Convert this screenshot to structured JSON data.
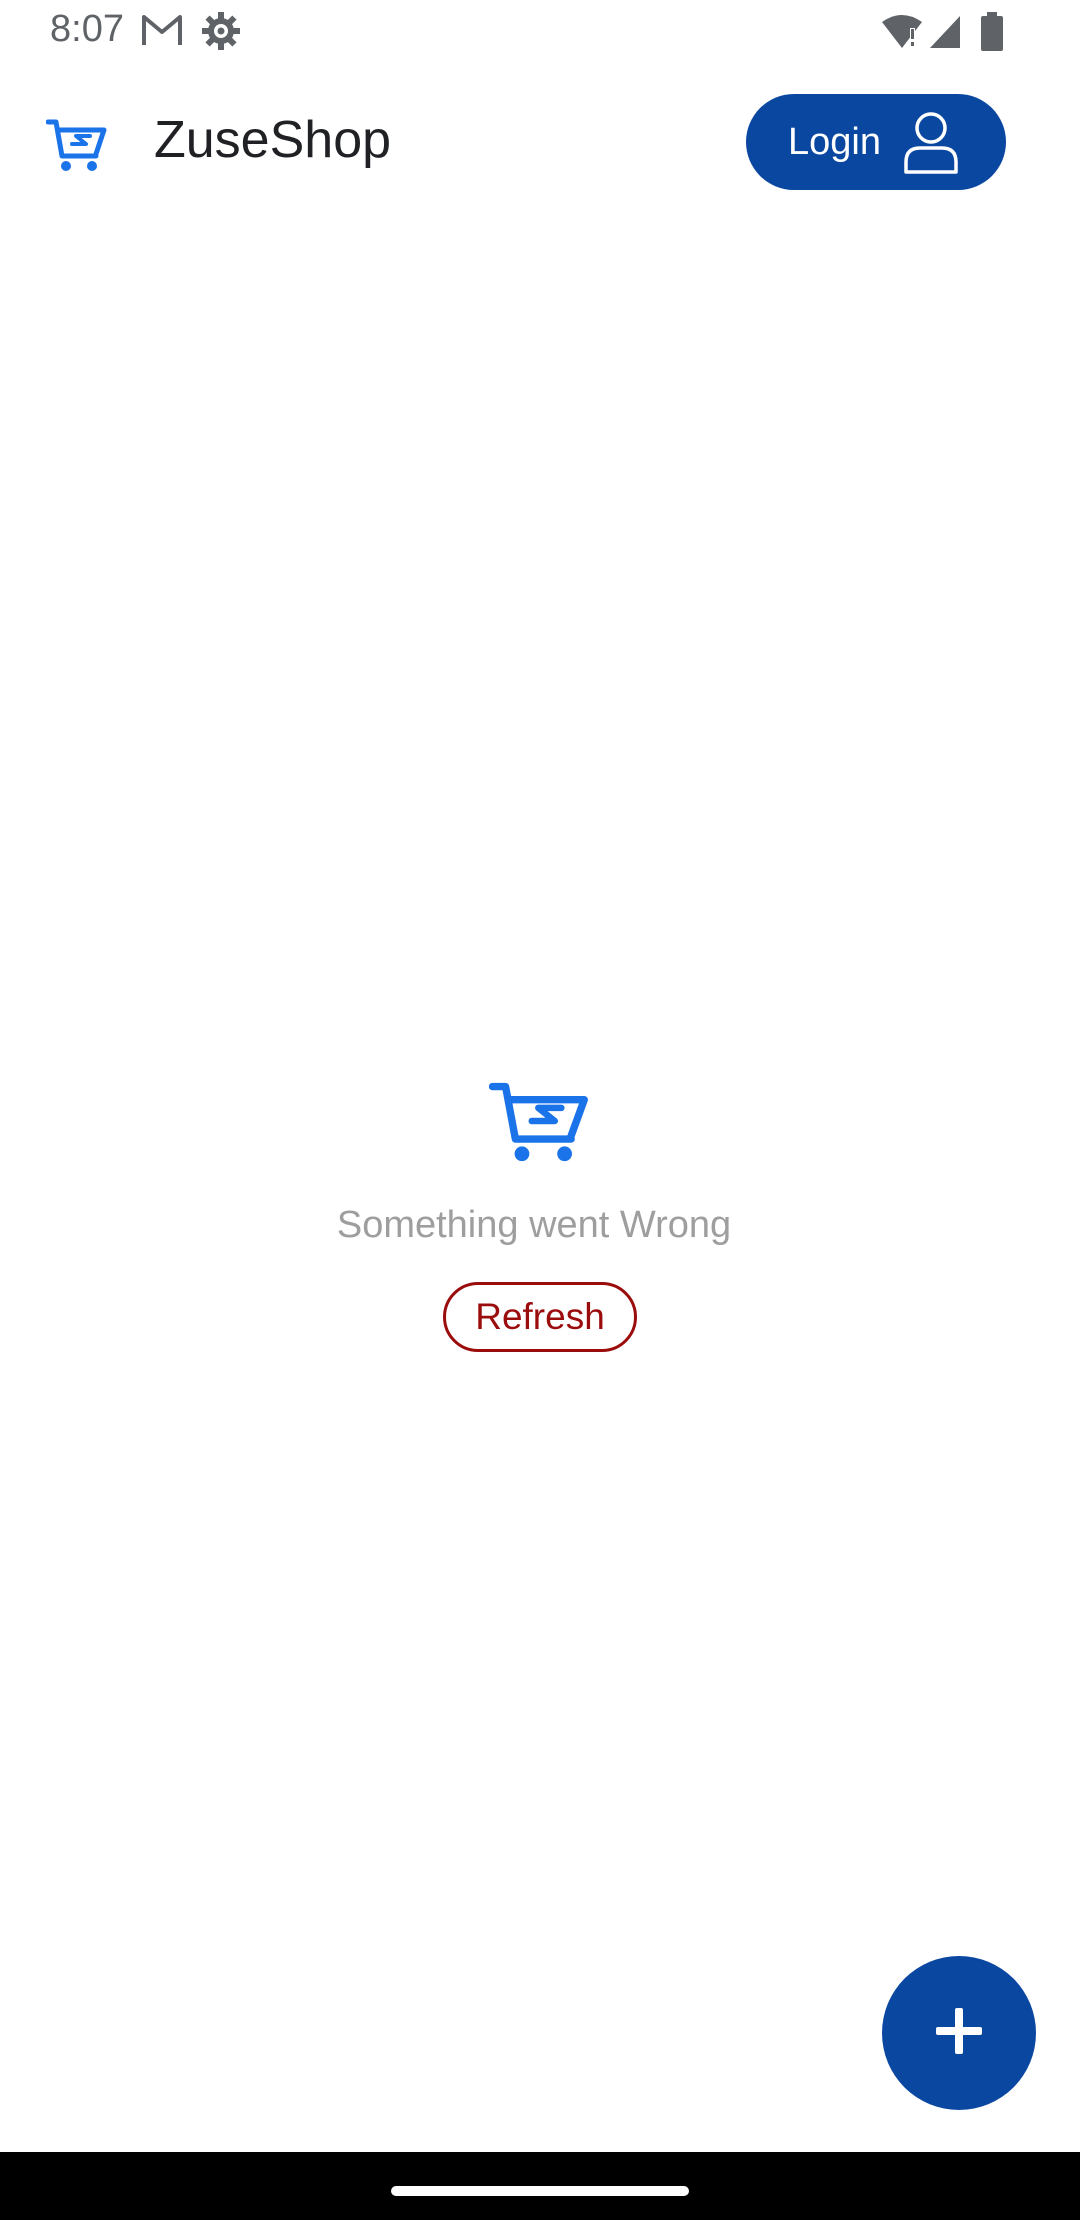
{
  "status_bar": {
    "time": "8:07",
    "icons": [
      "gmail-icon",
      "settings-gear-icon",
      "wifi-alert-icon",
      "cell-signal-icon",
      "battery-icon"
    ]
  },
  "app_bar": {
    "title": "ZuseShop",
    "logo_icon": "cart-icon",
    "login_label": "Login",
    "login_icon": "user-icon"
  },
  "error_state": {
    "icon": "cart-icon",
    "message": "Something went Wrong",
    "refresh_label": "Refresh"
  },
  "fab": {
    "icon": "plus-icon"
  },
  "colors": {
    "primary": "#0a47a1",
    "accent_blue": "#1a73e8",
    "error_red": "#9b0d0d",
    "muted_text": "#9e9e9e"
  }
}
